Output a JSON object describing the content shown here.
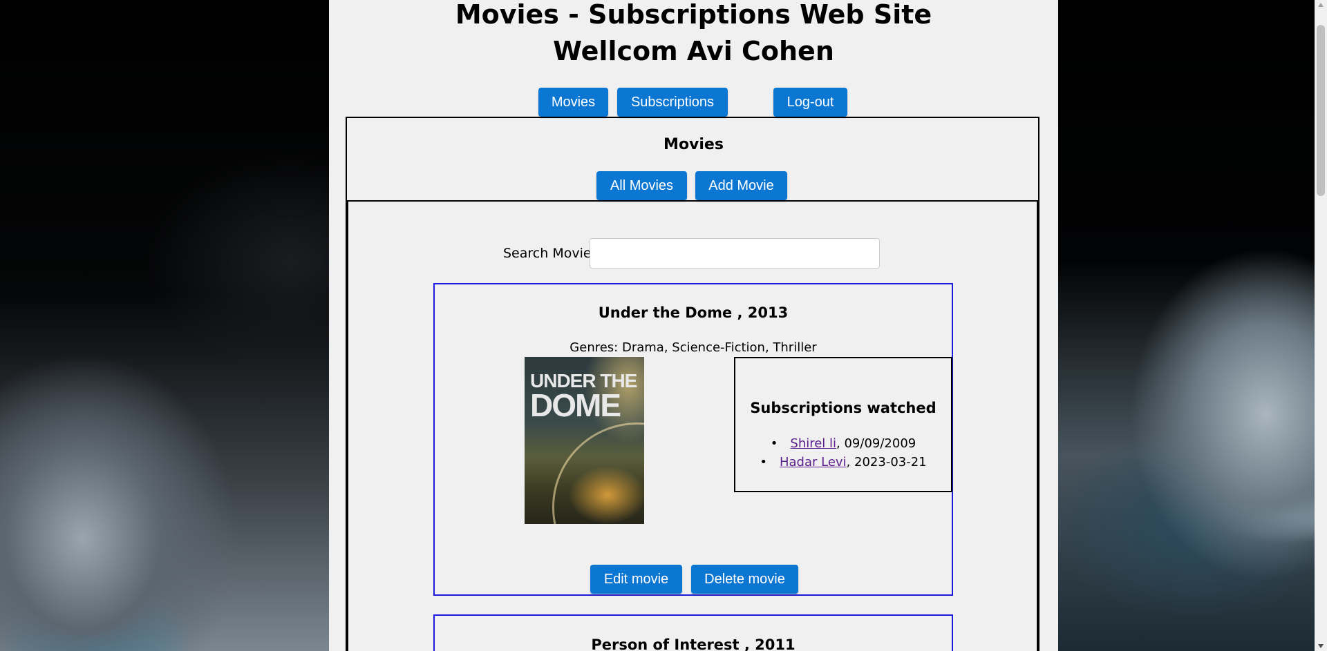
{
  "header": {
    "site_title": "Movies - Subscriptions Web Site",
    "welcome": "Wellcom Avi Cohen"
  },
  "nav": {
    "movies": "Movies",
    "subscriptions": "Subscriptions",
    "logout": "Log-out"
  },
  "movies_section": {
    "title": "Movies",
    "all_movies": "All Movies",
    "add_movie": "Add Movie",
    "search_label": "Search Movie",
    "search_value": ""
  },
  "movies": [
    {
      "title": "Under the Dome , 2013",
      "genres": "Genres: Drama, Science-Fiction, Thriller",
      "poster_line1": "UNDER THE",
      "poster_line2": "DOME",
      "subscriptions_title": "Subscriptions watched",
      "subscriptions": [
        {
          "name": "Shirel li",
          "date": ", 09/09/2009"
        },
        {
          "name": "Hadar Levi",
          "date": ", 2023-03-21"
        }
      ],
      "edit_label": "Edit movie",
      "delete_label": "Delete movie"
    },
    {
      "title": "Person of Interest , 2011"
    }
  ],
  "colors": {
    "button": "#0b77d2",
    "card_border": "#1a1adb",
    "link_visited": "#5a1d8c",
    "panel_bg": "#f0f0f0"
  }
}
